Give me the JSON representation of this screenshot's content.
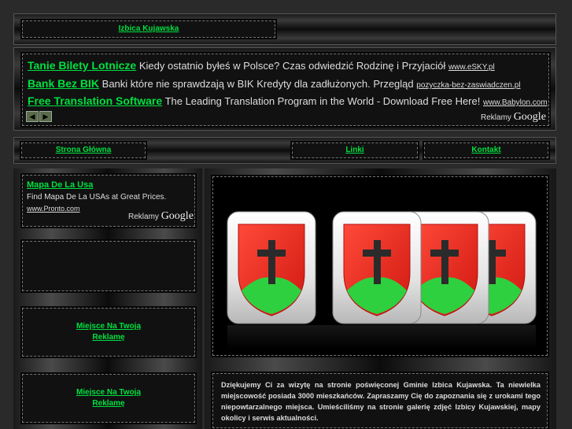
{
  "header": {
    "title": "Izbica Kujawska"
  },
  "ads_top": [
    {
      "title": "Tanie Bilety Lotnicze",
      "text": "Kiedy ostatnio byłeś w Polsce? Czas odwiedzić Rodzinę i Przyjaciół",
      "url": "www.eSKY.pl"
    },
    {
      "title": "Bank Bez BIK",
      "text": "Banki które nie sprawdzają w BIK Kredyty dla zadłużonych. Przegląd",
      "url": "pozyczka-bez-zaswiadczen.pl"
    },
    {
      "title": "Free Translation Software",
      "text": "The Leading Translation Program in the World - Download Free Here!",
      "url": "www.Babylon.com"
    }
  ],
  "reklamy": {
    "label": "Reklamy",
    "brand": "Google"
  },
  "nav": {
    "home": "Strona Główna",
    "links": "Linki",
    "contact": "Kontakt"
  },
  "side_ad": {
    "title": "Mapa De La Usa",
    "text": "Find Mapa De La USAs at Great Prices.",
    "url": "www.Pronto.com"
  },
  "place_ad": {
    "line1": "Miejsce Na Twoją",
    "line2": "Reklamę"
  },
  "intro": "Dziękujemy Ci za wizytę na stronie poświęconej Gminie Izbica Kujawska. Ta niewielka miejscowość posiada 3000 mieszkańców. Zapraszamy Cię do zapoznania się z urokami tego niepowtarzalnego miejsca. Umieściliśmy na stronie galerię zdjęć Izbicy Kujawskiej, mapy okolicy i serwis aktualności.",
  "colors": {
    "link": "#00e040",
    "shield_red": "#e8201a",
    "shield_green": "#2ecc40",
    "cross": "#2b2b2b"
  }
}
